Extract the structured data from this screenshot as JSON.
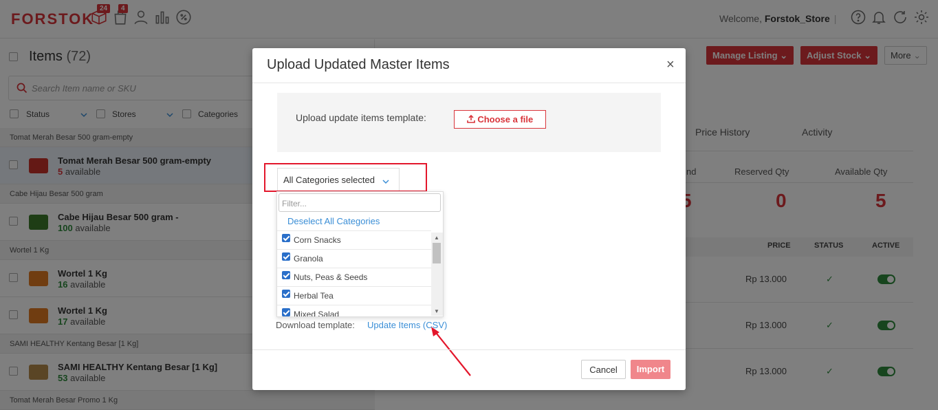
{
  "header": {
    "logo": "FORSTOK",
    "badges": {
      "orders": "24",
      "shipments": "4"
    },
    "welcome_prefix": "Welcome,",
    "store_name": "Forstok_Store",
    "separator": "|"
  },
  "left": {
    "title": "Items",
    "count": "(72)",
    "search_placeholder": "Search Item name or SKU",
    "filters": [
      "Status",
      "Stores",
      "Categories"
    ],
    "rows": [
      {
        "type": "group",
        "label": "Tomat Merah Besar 500 gram-empty"
      },
      {
        "type": "item",
        "name": "Tomat Merah Besar 500 gram-empty",
        "qty": "5",
        "avail": "available",
        "color": "red",
        "thumb": "#c8322a",
        "selected": true
      },
      {
        "type": "group",
        "label": "Cabe Hijau Besar 500 gram"
      },
      {
        "type": "item",
        "name": "Cabe Hijau Besar 500 gram -",
        "qty": "100",
        "avail": "available",
        "color": "green",
        "thumb": "#3c7a2a"
      },
      {
        "type": "group",
        "label": "Wortel 1 Kg"
      },
      {
        "type": "item",
        "name": "Wortel 1 Kg",
        "qty": "16",
        "avail": "available",
        "color": "green",
        "thumb": "#e07a22"
      },
      {
        "type": "item",
        "name": "Wortel 1 Kg",
        "qty": "17",
        "avail": "available",
        "color": "green",
        "thumb": "#e07a22"
      },
      {
        "type": "group",
        "label": "SAMI HEALTHY Kentang Besar [1 Kg]"
      },
      {
        "type": "item",
        "name": "SAMI HEALTHY Kentang Besar [1 Kg]",
        "qty": "53",
        "avail": "available",
        "color": "green",
        "thumb": "#b58a4a"
      },
      {
        "type": "group",
        "label": "Tomat Merah Besar Promo 1 Kg"
      }
    ]
  },
  "right": {
    "buttons": {
      "manage_listing": "Manage Listing",
      "adjust_stock": "Adjust Stock",
      "more": "More"
    },
    "tabs": [
      "Price History",
      "Activity"
    ],
    "stats": [
      {
        "label": "nd",
        "value": "5"
      },
      {
        "label": "Reserved Qty",
        "value": "0"
      },
      {
        "label": "Available Qty",
        "value": "5"
      }
    ],
    "columns": [
      "PRICE",
      "STATUS",
      "ACTIVE"
    ],
    "rows": [
      {
        "price": "Rp  13.000",
        "status": "✓"
      },
      {
        "price": "Rp  13.000",
        "status": "✓"
      },
      {
        "price": "Rp  13.000",
        "status": "✓"
      }
    ]
  },
  "modal": {
    "title": "Upload Updated Master Items",
    "close": "×",
    "upload_label": "Upload update items template:",
    "choose_file": "Choose a file",
    "category_select": "All Categories selected",
    "filter_placeholder": "Filter...",
    "deselect_all": "Deselect All Categories",
    "categories": [
      "Corn Snacks",
      "Granola",
      "Nuts, Peas & Seeds",
      "Herbal Tea",
      "Mixed Salad"
    ],
    "download_label": "Download template:",
    "download_link": "Update Items (CSV)",
    "cancel": "Cancel",
    "import": "Import"
  },
  "colors": {
    "brand": "#d9343a",
    "link": "#3a8ed6",
    "success": "#2e8b3d",
    "annotation": "#e3162b"
  }
}
